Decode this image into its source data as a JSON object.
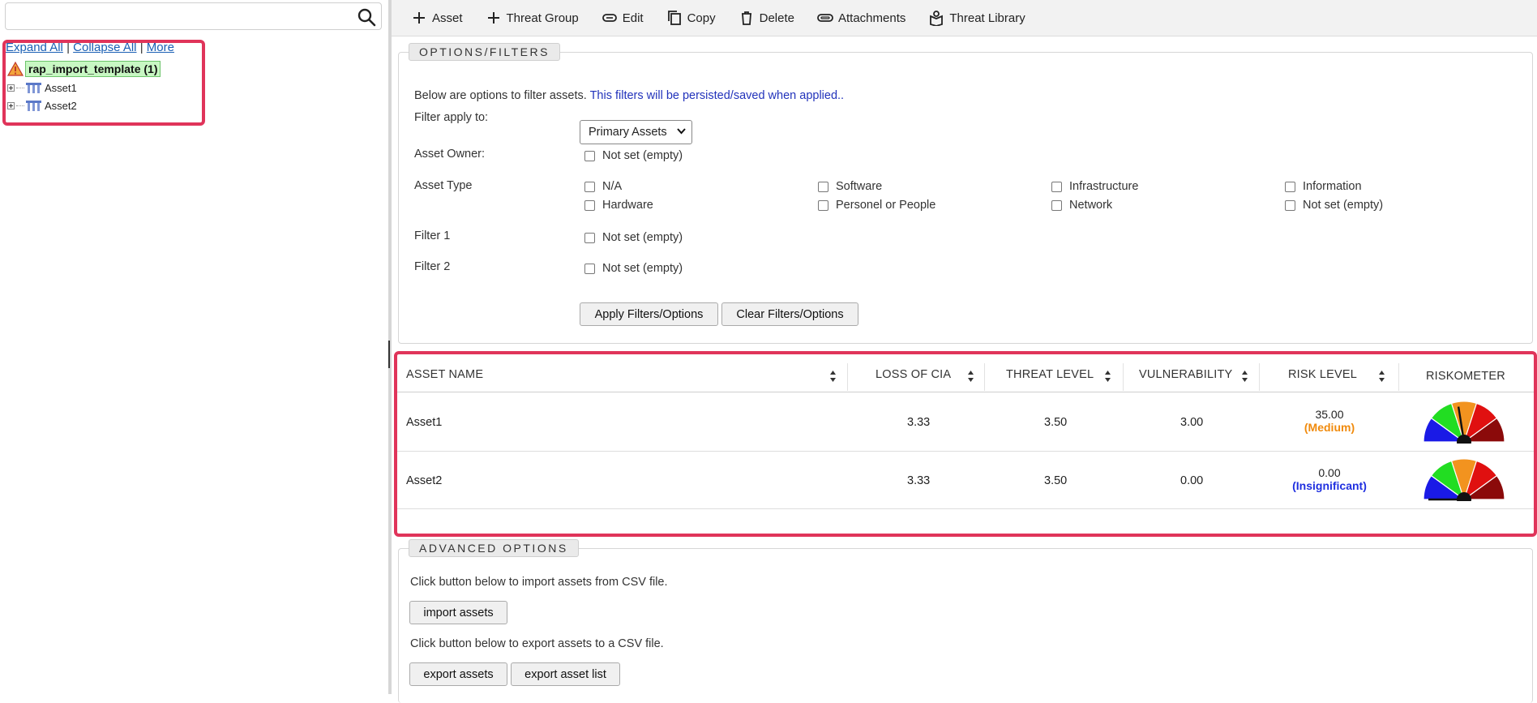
{
  "search": {
    "placeholder": ""
  },
  "tree": {
    "expand_all": "Expand All",
    "collapse_all": "Collapse All",
    "more": "More",
    "separator": "|",
    "root_label": "rap_import_template (1)",
    "nodes": [
      {
        "label": "Asset1"
      },
      {
        "label": "Asset2"
      }
    ]
  },
  "toolbar": {
    "asset": "Asset",
    "threat_group": "Threat Group",
    "edit": "Edit",
    "copy": "Copy",
    "delete": "Delete",
    "attachments": "Attachments",
    "threat_library": "Threat Library"
  },
  "filters": {
    "legend": "OPTIONS/FILTERS",
    "description": "Below are options to filter assets.",
    "note": "This filters will be persisted/saved when applied..",
    "apply_to_label": "Filter apply to:",
    "apply_to_value": "Primary Assets",
    "owner_label": "Asset Owner:",
    "owner_option": "Not set (empty)",
    "type_label": "Asset Type",
    "type_options": [
      "N/A",
      "Software",
      "Infrastructure",
      "Information",
      "Hardware",
      "Personel or People",
      "Network",
      "Not set (empty)"
    ],
    "filter1_label": "Filter 1",
    "filter1_option": "Not set (empty)",
    "filter2_label": "Filter 2",
    "filter2_option": "Not set (empty)",
    "apply_button": "Apply Filters/Options",
    "clear_button": "Clear Filters/Options"
  },
  "table": {
    "headers": {
      "name": "ASSET NAME",
      "loss": "LOSS OF CIA",
      "threat": "THREAT LEVEL",
      "vuln": "VULNERABILITY",
      "risk": "RISK LEVEL",
      "meter": "RISKOMETER"
    },
    "rows": [
      {
        "name": "Asset1",
        "loss": "3.33",
        "threat": "3.50",
        "vuln": "3.00",
        "risk": "35.00",
        "level": "(Medium)",
        "level_color": "#f08a0c",
        "needle": 0.45
      },
      {
        "name": "Asset2",
        "loss": "3.33",
        "threat": "3.50",
        "vuln": "0.00",
        "risk": "0.00",
        "level": "(Insignificant)",
        "level_color": "#1f2fe0",
        "needle": 0.0
      }
    ]
  },
  "advanced": {
    "legend": "ADVANCED OPTIONS",
    "import_text": "Click button below to import assets from CSV file.",
    "import_button": "import assets",
    "export_text": "Click button below to export assets to a CSV file.",
    "export_button": "export assets",
    "export_list_button": "export asset list"
  },
  "colors": {
    "highlight": "#e0345a",
    "gauge": [
      "#1a1ae6",
      "#22dd22",
      "#f2931f",
      "#e01010",
      "#8b0a0a"
    ]
  }
}
